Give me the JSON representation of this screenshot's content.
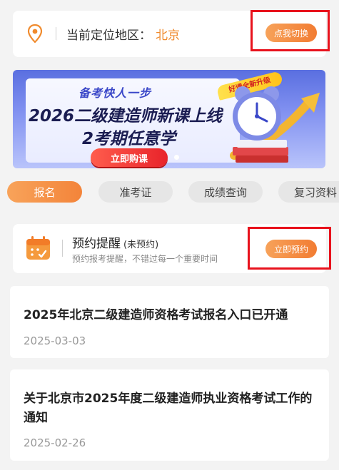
{
  "location": {
    "label": "当前定位地区：",
    "value": "北京",
    "switch_label": "点我切换"
  },
  "banner": {
    "subtitle": "备考快人一步",
    "title": "2026二级建造师新课上线",
    "title2": "2考期任意学",
    "tag": "好课全新升级",
    "button": "立即购课"
  },
  "tabs": [
    {
      "label": "报名",
      "active": true
    },
    {
      "label": "准考证",
      "active": false
    },
    {
      "label": "成绩查询",
      "active": false
    },
    {
      "label": "复习资料",
      "active": false
    }
  ],
  "reminder": {
    "title": "预约提醒",
    "status": "(未预约)",
    "description": "预约报考提醒，不错过每一个重要时间",
    "button": "立即预约"
  },
  "news": [
    {
      "title": "2025年北京二级建造师资格考试报名入口已开通",
      "date": "2025-03-03"
    },
    {
      "title": "关于北京市2025年度二级建造师执业资格考试工作的通知",
      "date": "2025-02-26"
    }
  ],
  "colors": {
    "accent": "#f27c32",
    "highlight_box": "#e8121c",
    "location_value": "#f08a2c"
  }
}
